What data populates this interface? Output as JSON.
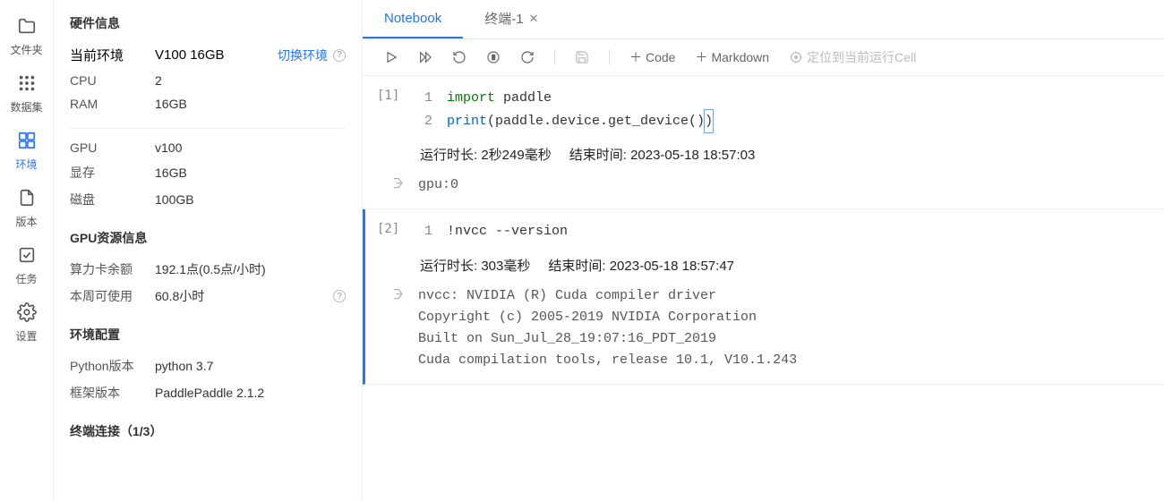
{
  "sidebar": {
    "items": [
      {
        "label": "文件夹"
      },
      {
        "label": "数据集"
      },
      {
        "label": "环境"
      },
      {
        "label": "版本"
      },
      {
        "label": "任务"
      },
      {
        "label": "设置"
      }
    ]
  },
  "info": {
    "hw_title": "硬件信息",
    "current_env_label": "当前环境",
    "current_env_value": "V100 16GB",
    "switch_env": "切换环境",
    "cpu_label": "CPU",
    "cpu_value": "2",
    "ram_label": "RAM",
    "ram_value": "16GB",
    "gpu_label": "GPU",
    "gpu_value": "v100",
    "vram_label": "显存",
    "vram_value": "16GB",
    "disk_label": "磁盘",
    "disk_value": "100GB",
    "gpu_res_title": "GPU资源信息",
    "quota_label": "算力卡余额",
    "quota_value": "192.1点(0.5点/小时)",
    "week_label": "本周可使用",
    "week_value": "60.8小时",
    "env_cfg_title": "环境配置",
    "py_label": "Python版本",
    "py_value": "python 3.7",
    "fw_label": "框架版本",
    "fw_value": "PaddlePaddle 2.1.2",
    "term_title": "终端连接（1/3）"
  },
  "tabs": {
    "notebook": "Notebook",
    "terminal": "终端-1"
  },
  "toolbar": {
    "code": "Code",
    "markdown": "Markdown",
    "locate": "定位到当前运行Cell"
  },
  "cells": [
    {
      "exec": "[1]",
      "lines": [
        {
          "n": "1",
          "html": "<span class='kw'>import</span> paddle"
        },
        {
          "n": "2",
          "html": "<span class='fn'>print</span>(paddle.device.get_device()<span class='cursor-box'>)</span>"
        }
      ],
      "meta_duration_label": "运行时长:",
      "meta_duration": "2秒249毫秒",
      "meta_end_label": "结束时间:",
      "meta_end": "2023-05-18 18:57:03",
      "output": "gpu:0"
    },
    {
      "exec": "[2]",
      "lines": [
        {
          "n": "1",
          "html": "!nvcc --version"
        }
      ],
      "meta_duration_label": "运行时长:",
      "meta_duration": "303毫秒",
      "meta_end_label": "结束时间:",
      "meta_end": "2023-05-18 18:57:47",
      "output": "nvcc: NVIDIA (R) Cuda compiler driver\nCopyright (c) 2005-2019 NVIDIA Corporation\nBuilt on Sun_Jul_28_19:07:16_PDT_2019\nCuda compilation tools, release 10.1, V10.1.243"
    }
  ]
}
